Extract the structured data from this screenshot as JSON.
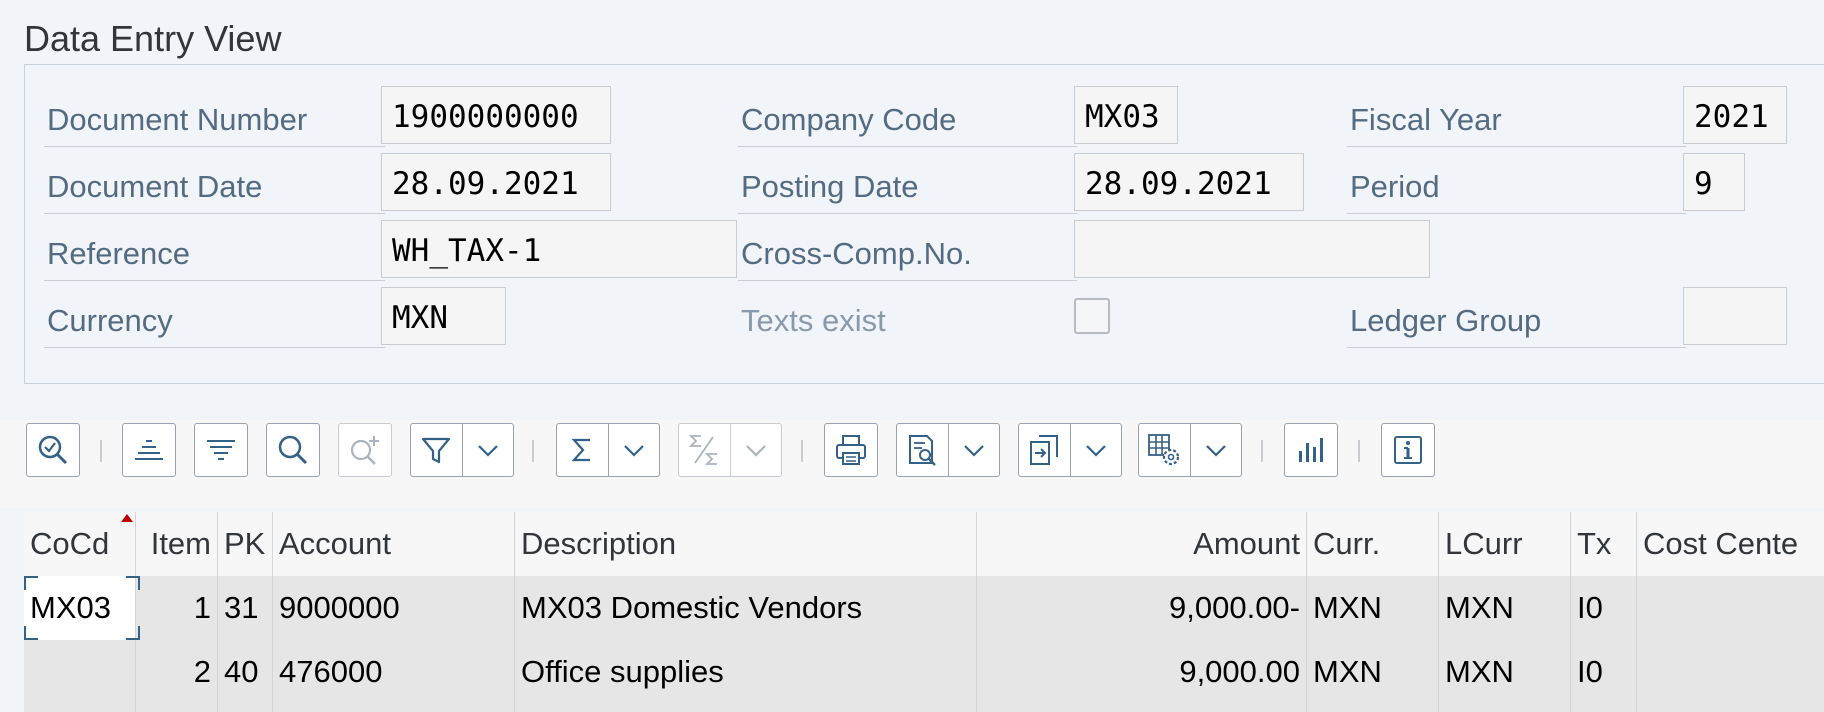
{
  "view_title": "Data Entry View",
  "header_fields": {
    "document_number": {
      "label": "Document Number",
      "value": "1900000000"
    },
    "company_code": {
      "label": "Company Code",
      "value": "MX03"
    },
    "fiscal_year": {
      "label": "Fiscal Year",
      "value": "2021"
    },
    "document_date": {
      "label": "Document Date",
      "value": "28.09.2021"
    },
    "posting_date": {
      "label": "Posting Date",
      "value": "28.09.2021"
    },
    "period": {
      "label": "Period",
      "value": "9"
    },
    "reference": {
      "label": "Reference",
      "value": "WH_TAX-1"
    },
    "cross_comp_no": {
      "label": "Cross-Comp.No.",
      "value": ""
    },
    "currency": {
      "label": "Currency",
      "value": "MXN"
    },
    "texts_exist": {
      "label": "Texts exist",
      "checked": false
    },
    "ledger_group": {
      "label": "Ledger Group",
      "value": ""
    }
  },
  "toolbar": {
    "buttons": [
      {
        "name": "details-button",
        "icon": "magnifier-check-icon"
      },
      {
        "name": "sort-ascending-button",
        "icon": "sort-ascending-icon"
      },
      {
        "name": "sort-descending-button",
        "icon": "sort-descending-icon"
      },
      {
        "name": "find-button",
        "icon": "search-icon"
      },
      {
        "name": "find-next-button",
        "icon": "search-plus-icon",
        "disabled": true
      },
      {
        "name": "filter-button",
        "icon": "filter-icon"
      },
      {
        "name": "total-button",
        "icon": "sigma-icon"
      },
      {
        "name": "subtotal-button",
        "icon": "subtotal-icon",
        "disabled": true
      },
      {
        "name": "print-preview-button",
        "icon": "printer-icon"
      },
      {
        "name": "views-button",
        "icon": "report-view-icon"
      },
      {
        "name": "export-button",
        "icon": "export-icon"
      },
      {
        "name": "layout-button",
        "icon": "grid-settings-icon"
      },
      {
        "name": "graphic-button",
        "icon": "bar-chart-icon"
      },
      {
        "name": "information-button",
        "icon": "info-icon"
      }
    ]
  },
  "items_table": {
    "columns": [
      "CoCd",
      "Item",
      "PK",
      "Account",
      "Description",
      "Amount",
      "Curr.",
      "LCurr",
      "Tx",
      "Cost Cente"
    ],
    "rows": [
      [
        "MX03",
        "1",
        "31",
        "9000000",
        "MX03 Domestic Vendors",
        "9,000.00-",
        "MXN",
        "MXN",
        "I0",
        ""
      ],
      [
        "",
        "2",
        "40",
        "476000",
        "Office supplies",
        "9,000.00",
        "MXN",
        "MXN",
        "I0",
        ""
      ]
    ]
  },
  "colors": {
    "background": "#f1f4f9",
    "label": "#556b82",
    "icon": "#346187",
    "row_bg": "#e6e6e6",
    "sort_marker": "#bb0000"
  }
}
